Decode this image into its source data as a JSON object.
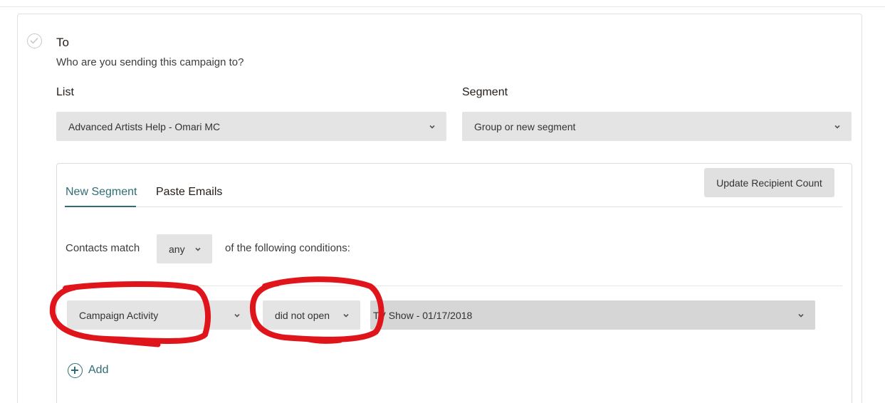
{
  "section": {
    "title": "To",
    "subtitle": "Who are you sending this campaign to?"
  },
  "list_field": {
    "label": "List",
    "value": "Advanced Artists Help - Omari MC"
  },
  "segment_field": {
    "label": "Segment",
    "value": "Group or new segment"
  },
  "tabs": [
    {
      "label": "New Segment",
      "active": true
    },
    {
      "label": "Paste Emails",
      "active": false
    }
  ],
  "update_button": "Update Recipient Count",
  "match": {
    "prefix": "Contacts match",
    "value": "any",
    "suffix": "of the following conditions:"
  },
  "condition": {
    "field": "Campaign Activity",
    "operator": "did not open",
    "campaign": "TV Show - 01/17/2018"
  },
  "add_label": "Add",
  "annotation_color": "#e0151c",
  "accent_color": "#2e6d74"
}
